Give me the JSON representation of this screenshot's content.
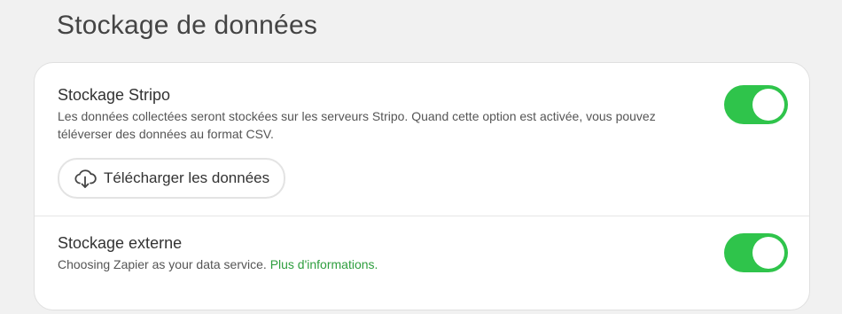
{
  "page": {
    "title": "Stockage de données"
  },
  "stripo_storage": {
    "title": "Stockage Stripo",
    "description": "Les données collectées seront stockées sur les serveurs Stripo. Quand cette option est activée, vous pouvez téléverser des données au format CSV.",
    "toggle_on": true,
    "download_button_label": "Télécharger les données",
    "download_icon": "cloud-download-icon"
  },
  "external_storage": {
    "title": "Stockage externe",
    "description": "Choosing Zapier as your data service.",
    "link_label": "Plus d'informations.",
    "toggle_on": true
  },
  "colors": {
    "toggle_on": "#2fc44b",
    "link": "#2e9e3e",
    "background": "#f1f1f1",
    "card": "#ffffff"
  }
}
